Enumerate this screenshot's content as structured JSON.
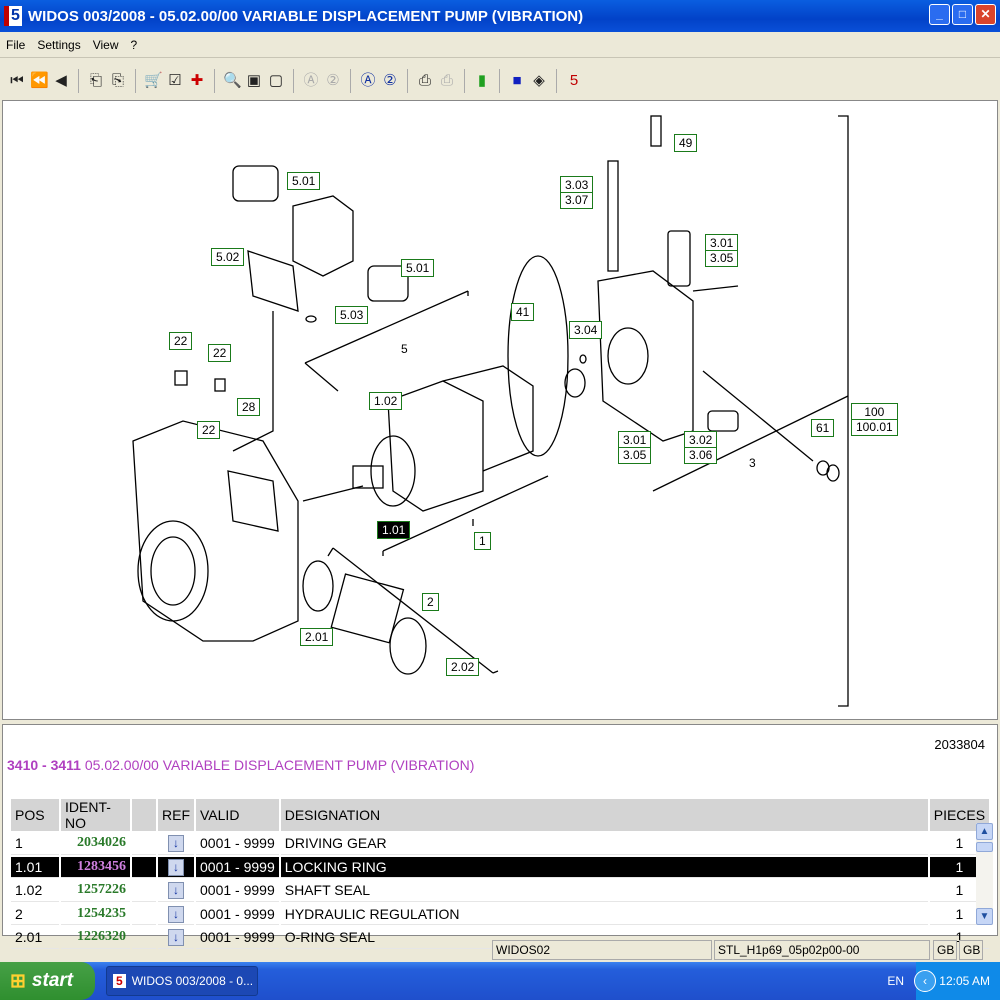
{
  "window": {
    "title": "WIDOS 003/2008 - 05.02.00/00 VARIABLE DISPLACEMENT PUMP (VIBRATION)",
    "logo": "5",
    "minimize": "_",
    "maximize": "□",
    "close": "✕"
  },
  "menu": [
    "File",
    "Settings",
    "View",
    "?"
  ],
  "toolbar": [
    {
      "name": "first-icon",
      "glyph": "⏮"
    },
    {
      "name": "fast-back-icon",
      "glyph": "⏪"
    },
    {
      "name": "back-icon",
      "glyph": "◀"
    },
    "sep",
    {
      "name": "page-prev-icon",
      "glyph": "⎗"
    },
    {
      "name": "page-next-icon",
      "glyph": "⎘"
    },
    "sep",
    {
      "name": "cart-icon",
      "glyph": "🛒"
    },
    {
      "name": "checklist-icon",
      "glyph": "☑"
    },
    {
      "name": "add-red-cross-icon",
      "glyph": "✚",
      "color": "#cc0000"
    },
    "sep",
    {
      "name": "zoom-in-icon",
      "glyph": "🔍"
    },
    {
      "name": "page-view-icon",
      "glyph": "▣"
    },
    {
      "name": "page-icon",
      "glyph": "▢"
    },
    "sep",
    {
      "name": "search-a-disabled-icon",
      "glyph": "Ⓐ",
      "disabled": true
    },
    {
      "name": "search-2-disabled-icon",
      "glyph": "②",
      "disabled": true
    },
    "sep",
    {
      "name": "search-a-icon",
      "glyph": "Ⓐ",
      "color": "#1030a0"
    },
    {
      "name": "search-2-icon",
      "glyph": "②",
      "color": "#1030a0"
    },
    "sep",
    {
      "name": "print-icon",
      "glyph": "⎙"
    },
    {
      "name": "print-disabled-icon",
      "glyph": "⎙",
      "disabled": true
    },
    "sep",
    {
      "name": "notepad-icon",
      "glyph": "▮",
      "color": "#20a020"
    },
    "sep",
    {
      "name": "eu-flag-icon",
      "glyph": "■",
      "color": "#1020c0"
    },
    {
      "name": "eraser-icon",
      "glyph": "◈"
    },
    "sep",
    {
      "name": "app-logo-icon",
      "glyph": "5",
      "color": "#c00000"
    }
  ],
  "diagram": {
    "labels": [
      "49",
      "3.03",
      "3.07",
      "5.01",
      "3.01",
      "3.05",
      "5.02",
      "5.01",
      "41",
      "3.04",
      "5.03",
      "5",
      "22",
      "22",
      "28",
      "1.02",
      "22",
      "100",
      "100.01",
      "61",
      "3.01",
      "3.05",
      "3.02",
      "3.06",
      "3",
      "1.01",
      "1",
      "2",
      "2.01",
      "2.02"
    ]
  },
  "parts": {
    "ident": "2033804",
    "heading_range": "3410 - 3411",
    "heading_title": "05.02.00/00 VARIABLE DISPLACEMENT PUMP (VIBRATION)",
    "columns": [
      "POS",
      "IDENT-NO",
      "",
      "REF",
      "VALID",
      "DESIGNATION",
      "PIECES"
    ],
    "rows": [
      {
        "pos": "1",
        "ident": "2034026",
        "ref": "↓",
        "valid": "0001 - 9999",
        "designation": "DRIVING GEAR",
        "pieces": "1"
      },
      {
        "pos": "1.01",
        "ident": "1283456",
        "ref": "↓",
        "valid": "0001 - 9999",
        "designation": "LOCKING RING",
        "pieces": "1",
        "selected": true
      },
      {
        "pos": "1.02",
        "ident": "1257226",
        "ref": "↓",
        "valid": "0001 - 9999",
        "designation": "SHAFT SEAL",
        "pieces": "1"
      },
      {
        "pos": "2",
        "ident": "1254235",
        "ref": "↓",
        "valid": "0001 - 9999",
        "designation": "HYDRAULIC REGULATION",
        "pieces": "1"
      },
      {
        "pos": "2.01",
        "ident": "1226320",
        "ref": "↓",
        "valid": "0001 - 9999",
        "designation": "O-RING SEAL",
        "pieces": "1"
      }
    ]
  },
  "status": {
    "db": "WIDOS02",
    "file": "STL_H1p69_05p02p00-00",
    "lang1": "GB",
    "lang2": "GB"
  },
  "taskbar": {
    "start": "start",
    "task": "WIDOS 003/2008 - 0...",
    "lang": "EN",
    "time": "12:05 AM"
  }
}
